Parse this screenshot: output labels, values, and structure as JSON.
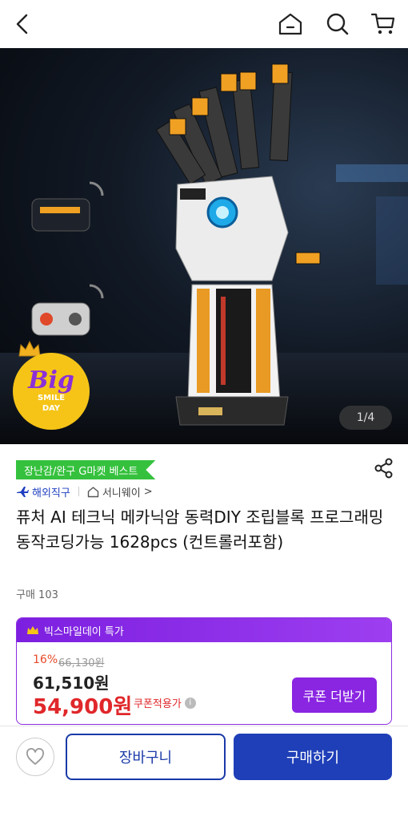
{
  "nav": {
    "icons": [
      "chevron-left-icon",
      "home-icon",
      "search-icon",
      "cart-icon"
    ]
  },
  "hero": {
    "counter": "1/4",
    "badge_big": "Big",
    "badge_line1": "SMILE",
    "badge_line2": "DAY"
  },
  "product": {
    "tag": "장난감/완구 G마켓 베스트",
    "overseas": "해외직구",
    "seller": "서니웨이",
    "seller_chevron": ">",
    "title": "퓨처 AI 테크닉 메카닉암 동력DIY 조립블록 프로그래밍 동작코딩가능 1628pcs (컨트롤러포함)",
    "bought": "구매 103"
  },
  "price": {
    "header": "빅스마일데이 특가",
    "discount": "16%",
    "original": "66,130원",
    "sale": "61,510원",
    "coupon_price": "54,900원",
    "coupon_applied": "쿠폰적용가",
    "info_icon": "i",
    "coupon_button": "쿠폰 더받기"
  },
  "bottom": {
    "cart_button": "장바구니",
    "buy_button": "구매하기"
  },
  "colors": {
    "brand_blue": "#1f3fb8",
    "promo_purple": "#8a25e2",
    "price_red": "#e0272a",
    "tag_green": "#35c13d"
  }
}
